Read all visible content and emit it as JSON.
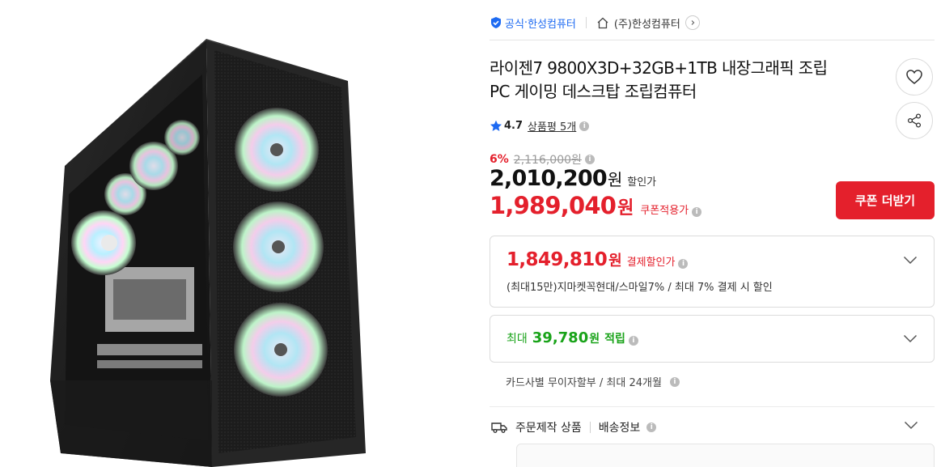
{
  "seller": {
    "official_label": "공식",
    "official_store": "한성컴퓨터",
    "store_name": "(주)한성컴퓨터"
  },
  "product": {
    "title_line1": "라이젠7 9800X3D+32GB+1TB 내장그래픽 조립",
    "title_line2": "PC 게이밍 데스크탑 조립컴퓨터"
  },
  "rating": {
    "value": "4.7",
    "review_label": "상품평 5개"
  },
  "price": {
    "discount_rate": "6%",
    "original_price": "2,116,000원",
    "sale_price": "2,010,200",
    "sale_unit": "원",
    "sale_tag": "할인가",
    "coupon_price": "1,989,040",
    "coupon_unit": "원",
    "coupon_tag": "쿠폰적용가",
    "coupon_button": "쿠폰 더받기"
  },
  "payment": {
    "price": "1,849,810",
    "unit": "원",
    "tag": "결제할인가",
    "description": "(최대15만)지마켓꼭현대/스마일7% / 최대 7% 결제 시 할인"
  },
  "points": {
    "prefix": "최대",
    "amount": "39,780",
    "unit": "원",
    "tag": "적립"
  },
  "installment": {
    "text": "카드사별 무이자할부 / 최대 24개월"
  },
  "shipping": {
    "made_to_order": "주문제작 상품",
    "shipping_info": "배송정보"
  },
  "colors": {
    "accent_red": "#e4202c",
    "official_blue": "#1d6af2",
    "point_green": "#19a319"
  },
  "icons": {
    "official": "shield-check-icon",
    "home": "home-icon",
    "wish": "heart-icon",
    "share": "share-icon",
    "star": "star-icon",
    "info": "info-icon",
    "chevron": "chevron-down-icon",
    "truck": "truck-icon"
  }
}
